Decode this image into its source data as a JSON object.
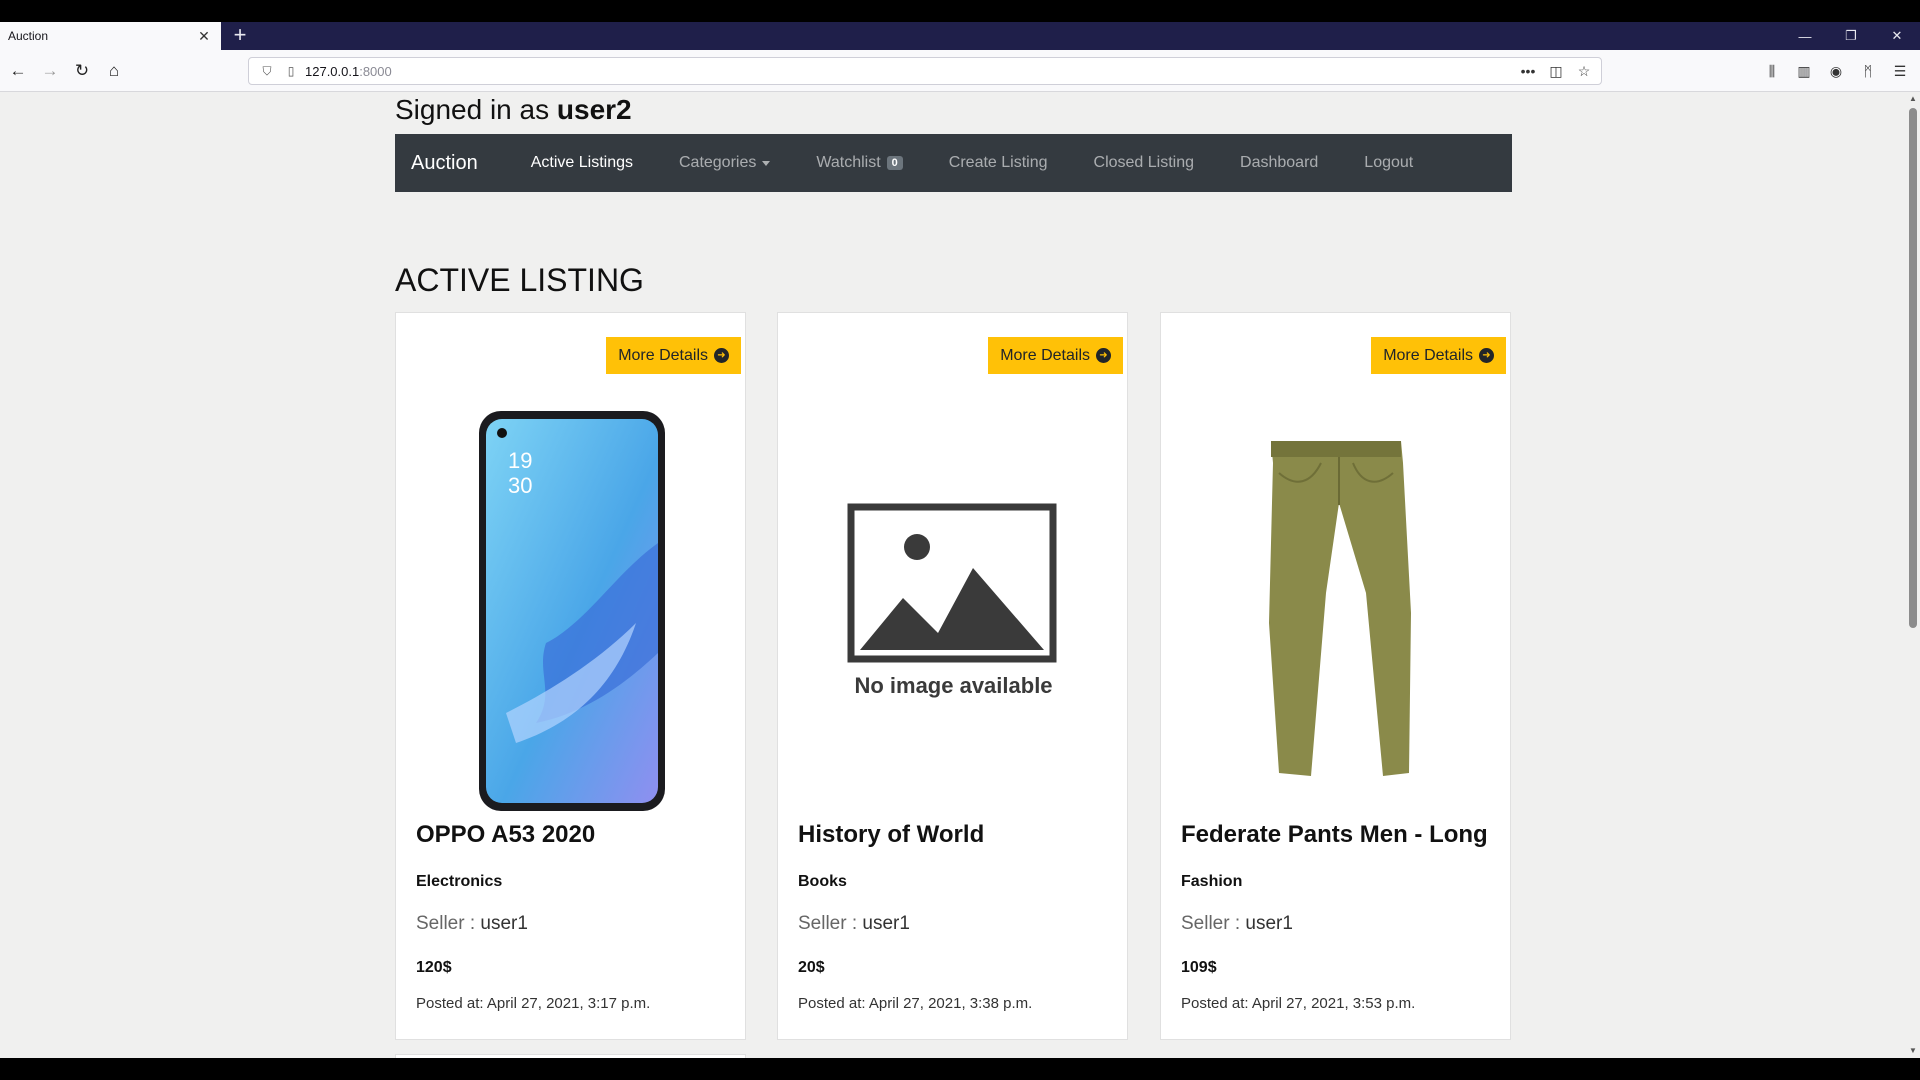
{
  "browser": {
    "tab_title": "Auction",
    "url_host": "127.0.0.1",
    "url_port": ":8000"
  },
  "page": {
    "signed_prefix": "Signed in as",
    "username": "user2",
    "heading": "ACTIVE LISTING",
    "navbar": {
      "brand": "Auction",
      "items": [
        {
          "label": "Active Listings"
        },
        {
          "label": "Categories"
        },
        {
          "label": "Watchlist",
          "badge": "0"
        },
        {
          "label": "Create Listing"
        },
        {
          "label": "Closed Listing"
        },
        {
          "label": "Dashboard"
        },
        {
          "label": "Logout"
        }
      ]
    },
    "more_details_label": "More Details",
    "seller_label": "Seller :",
    "posted_label": "Posted at:",
    "no_image_text": "No image available",
    "listings": [
      {
        "title": "OPPO A53 2020",
        "category": "Electronics",
        "seller": "user1",
        "price": "120$",
        "posted": "April 27, 2021, 3:17 p.m.",
        "phone_time_h": "19",
        "phone_time_m": "30"
      },
      {
        "title": "History of World",
        "category": "Books",
        "seller": "user1",
        "price": "20$",
        "posted": "April 27, 2021, 3:38 p.m."
      },
      {
        "title": "Federate Pants Men - Long",
        "category": "Fashion",
        "seller": "user1",
        "price": "109$",
        "posted": "April 27, 2021, 3:53 p.m."
      }
    ]
  },
  "colors": {
    "navbar_bg": "#343a40",
    "button_yellow": "#ffc107",
    "tab_strip": "#1f1f4a",
    "page_bg": "#f0f0ef"
  }
}
